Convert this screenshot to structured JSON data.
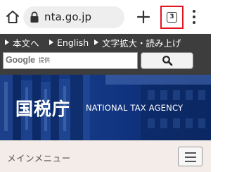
{
  "browser": {
    "url": "nta.go.jp",
    "tab_count": "3",
    "icons": [
      "home-icon",
      "lock-icon",
      "plus-icon",
      "tab-switcher-icon",
      "more-vert-icon"
    ],
    "highlight_color": "#e3141d"
  },
  "utility_links": [
    {
      "label": "本文へ"
    },
    {
      "label": "English"
    },
    {
      "label": "文字拡大・読み上げ"
    }
  ],
  "search": {
    "logo_text": "Google",
    "provided_label": "提供",
    "button_icon": "magnifier-icon"
  },
  "hero": {
    "title": "国税庁",
    "subtitle": "NATIONAL TAX AGENCY",
    "background_color": "#123480"
  },
  "main_menu": {
    "label": "メインメニュー",
    "button_icon": "hamburger-icon",
    "background_color": "#f3ece8"
  }
}
